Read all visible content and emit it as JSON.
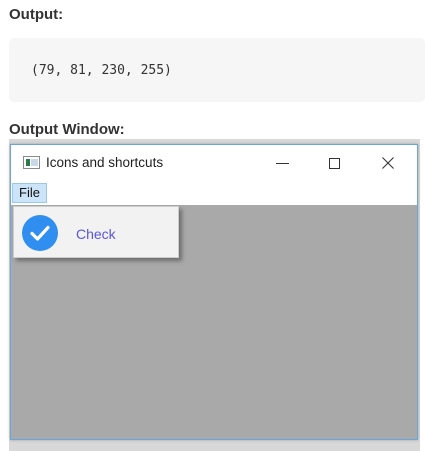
{
  "headings": {
    "output": "Output:",
    "output_window": "Output Window:"
  },
  "code": {
    "text": "(79, 81, 230, 255)"
  },
  "window": {
    "title": "Icons and shortcuts",
    "controls": {
      "minimize": "—",
      "maximize": "□",
      "close": "✕"
    }
  },
  "menubar": {
    "file_label": "File"
  },
  "file_menu": {
    "items": [
      {
        "label": "Check",
        "icon": "check-circle-icon",
        "icon_color": "#2f8ef0"
      }
    ]
  },
  "colors": {
    "accent": "#2f8ef0",
    "client_bg": "#a9a9a9",
    "menu_label": "#5b57d6"
  }
}
